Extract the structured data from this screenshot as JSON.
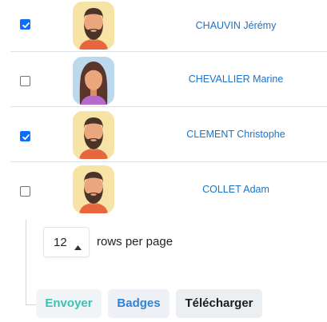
{
  "users": [
    {
      "name": "CHAUVIN Jérémy",
      "checked": true,
      "avatar": "man-bearded-avatar"
    },
    {
      "name": "CHEVALLIER Marine",
      "checked": false,
      "avatar": "woman-avatar"
    },
    {
      "name": "CLEMENT Christophe",
      "checked": true,
      "avatar": "man-bearded-avatar"
    },
    {
      "name": "COLLET Adam",
      "checked": false,
      "avatar": "man-bearded-avatar"
    }
  ],
  "pagination": {
    "rows_value": "12",
    "rows_label": "rows per page"
  },
  "actions": {
    "send_label": "Envoyer",
    "badges_label": "Badges",
    "download_label": "Télécharger"
  },
  "colors": {
    "checkbox": "#0d6efd",
    "name_link": "#1a73c8",
    "send_text": "#3cc1b1",
    "badges_text": "#2f82d6"
  }
}
